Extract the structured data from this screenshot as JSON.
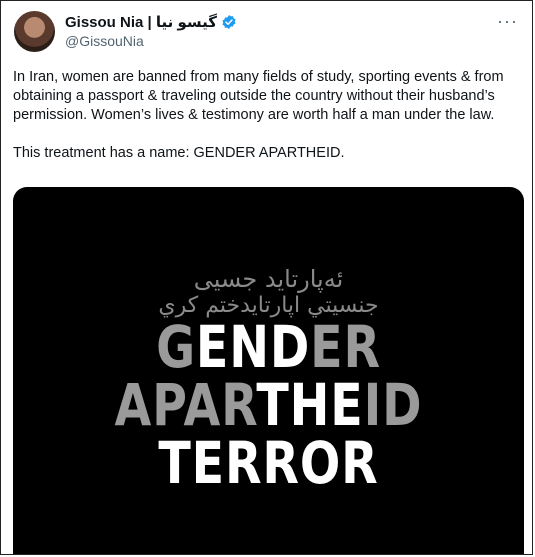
{
  "author": {
    "display_name": "Gissou Nia | گیسو نیا",
    "handle": "@GissouNia"
  },
  "tweet": {
    "text": "In Iran, women are banned from many fields of study, sporting events & from obtaining a passport & traveling outside the country without their husband’s permission. Women’s lives & testimony are worth half a man under the law.\n\nThis treatment has a name: GENDER APARTHEID."
  },
  "media": {
    "farsi_line1": "ئەپارتاید جسیی",
    "farsi_line2": "جنسيتي اپارتايدختم كري",
    "line1_grey_a": "G",
    "line1_white": "END",
    "line1_grey_b": "ER",
    "line2_grey_a": "APAR",
    "line2_white": "THE",
    "line2_grey_b": "ID",
    "line3_white": "TERROR"
  },
  "colors": {
    "verified_badge": "#1d9bf0",
    "text": "#0f1419",
    "secondary": "#536471"
  }
}
